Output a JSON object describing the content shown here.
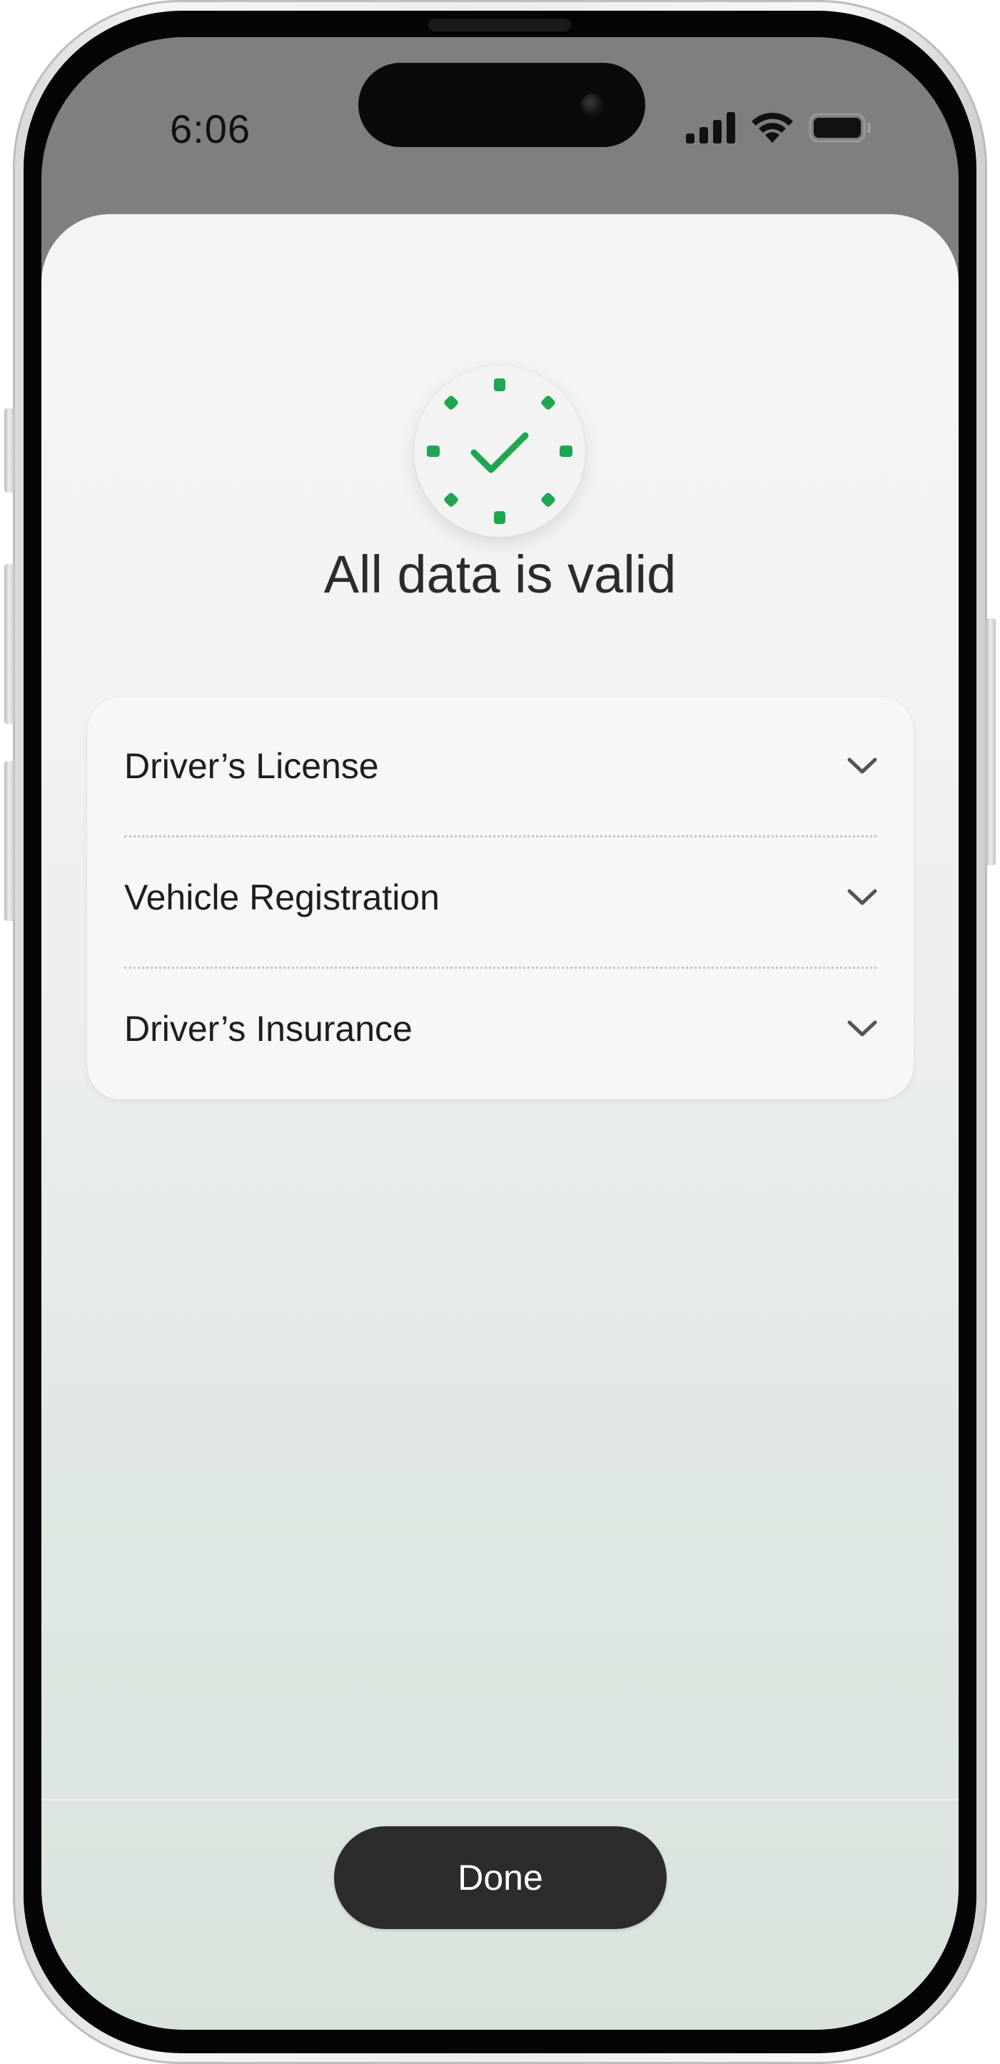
{
  "status_bar": {
    "time": "6:06"
  },
  "result": {
    "title": "All data is valid",
    "icon": "clock-checkmark-icon",
    "accent_color": "#1ea653"
  },
  "documents": [
    {
      "label": "Driver’s License"
    },
    {
      "label": "Vehicle Registration"
    },
    {
      "label": "Driver’s Insurance"
    }
  ],
  "footer": {
    "done_label": "Done"
  }
}
